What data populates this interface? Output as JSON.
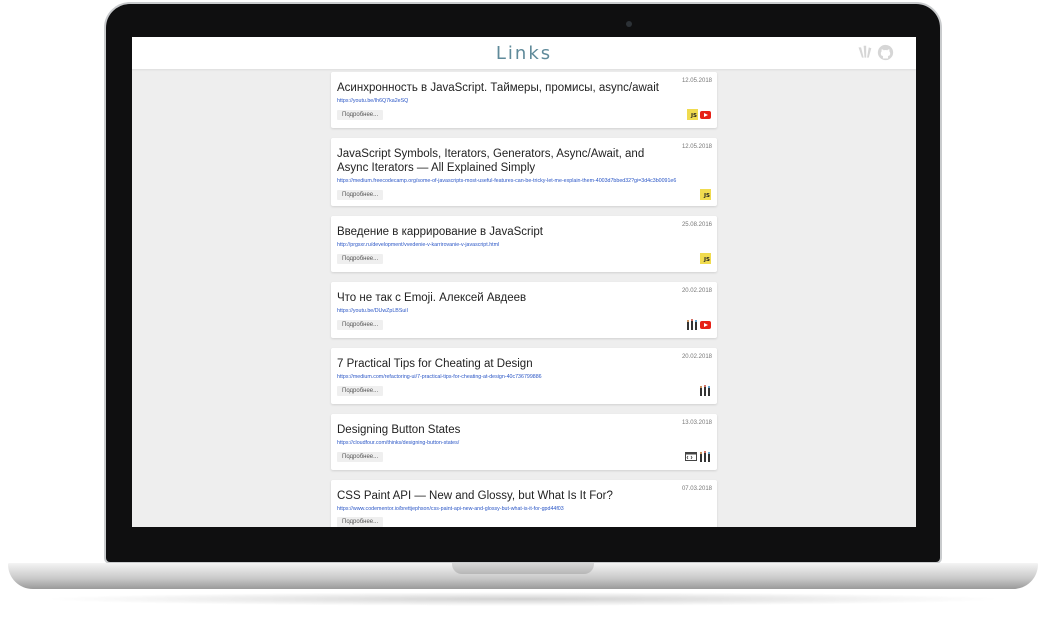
{
  "app": {
    "title": "Links",
    "header_icons": [
      "design-logo-icon",
      "github-icon"
    ]
  },
  "more_label": "Подробнее...",
  "links": [
    {
      "title": "Асинхронность в JavaScript. Таймеры, промисы, async/await",
      "url": "https://youtu.be/Ih6Q7ka2eSQ",
      "date": "12.05.2018",
      "tags": [
        "js",
        "youtube"
      ]
    },
    {
      "title": "JavaScript Symbols, Iterators, Generators, Async/Await, and Async Iterators — All Explained Simply",
      "url": "https://medium.freecodecamp.org/some-of-javascripts-most-useful-features-can-be-tricky-let-me-explain-them-4003d7bbed32?gi=3d4c3b0091e6",
      "date": "12.05.2018",
      "tags": [
        "js"
      ]
    },
    {
      "title": "Введение в каррирование в JavaScript",
      "url": "http://prgsxr.ru/development/vvedenie-v-karrirovanie-v-javascript.html",
      "date": "25.08.2016",
      "tags": [
        "js"
      ]
    },
    {
      "title": "Что не так с Emoji. Алексей Авдеев",
      "url": "https://youtu.be/DUwZpLBSuiI",
      "date": "20.02.2018",
      "tags": [
        "design",
        "youtube"
      ]
    },
    {
      "title": "7 Practical Tips for Cheating at Design",
      "url": "https://medium.com/refactoring-ui/7-practical-tips-for-cheating-at-design-40c736799886",
      "date": "20.02.2018",
      "tags": [
        "design"
      ]
    },
    {
      "title": "Designing Button States",
      "url": "https://cloudfour.com/thinks/designing-button-states/",
      "date": "13.03.2018",
      "tags": [
        "code",
        "design"
      ]
    },
    {
      "title": "CSS Paint API — New and Glossy, but What Is It For?",
      "url": "https://www.codementor.io/brettjephson/css-paint-api-new-and-glossy-but-what-is-it-for-gpd44f03",
      "date": "07.03.2018",
      "tags": []
    }
  ]
}
